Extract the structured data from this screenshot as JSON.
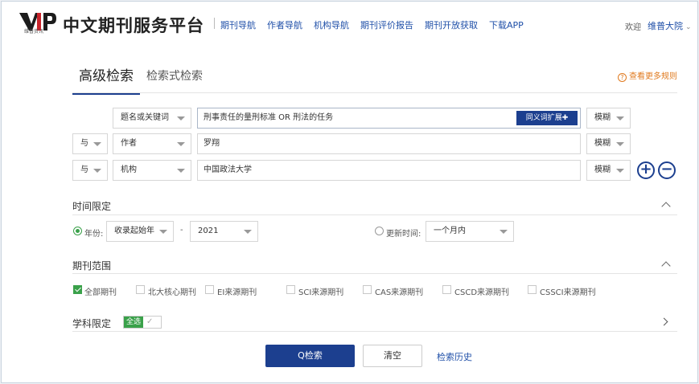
{
  "header": {
    "logo_text": "VIP",
    "logo_sub": "维普资讯",
    "title": "中文期刊服务平台",
    "nav": [
      "期刊导航",
      "作者导航",
      "机构导航",
      "期刊评价报告",
      "期刊开放获取",
      "下载APP"
    ],
    "welcome": "欢迎",
    "user": "维普大院"
  },
  "tabs": {
    "active": "高级检索",
    "other": "检索式检索"
  },
  "rules_link": "查看更多规则",
  "rules_icon": "?",
  "search_rows": [
    {
      "bool": "",
      "field": "题名或关键词",
      "value": "刑事责任的量刑标准 OR 刑法的任务",
      "match": "模糊"
    },
    {
      "bool": "与",
      "field": "作者",
      "value": "罗翔",
      "match": "模糊"
    },
    {
      "bool": "与",
      "field": "机构",
      "value": "中国政法大学",
      "match": "模糊"
    }
  ],
  "synonym_button": "同义词扩展✚",
  "add_row_symbol": "+",
  "remove_row_symbol": "−",
  "time_section": {
    "title": "时间限定",
    "year_label": "年份:",
    "from": "收录起始年",
    "dash": "-",
    "to": "2021",
    "update_label": "更新时间:",
    "update_value": "一个月内"
  },
  "journal_section": {
    "title": "期刊范围",
    "options": [
      {
        "label": "全部期刊",
        "checked": true
      },
      {
        "label": "北大核心期刊",
        "checked": false
      },
      {
        "label": "EI来源期刊",
        "checked": false
      },
      {
        "label": "SCI来源期刊",
        "checked": false
      },
      {
        "label": "CAS来源期刊",
        "checked": false
      },
      {
        "label": "CSCD来源期刊",
        "checked": false
      },
      {
        "label": "CSSCI来源期刊",
        "checked": false
      }
    ]
  },
  "subject_section": {
    "title": "学科限定",
    "all_label": "全选",
    "tick": "✓"
  },
  "actions": {
    "search": "Q检索",
    "clear": "清空",
    "history": "检索历史"
  },
  "colors": {
    "brand": "#1c3f8f",
    "link": "#1f4fa8",
    "accent": "#e07a1f",
    "check": "#3aa14a"
  }
}
